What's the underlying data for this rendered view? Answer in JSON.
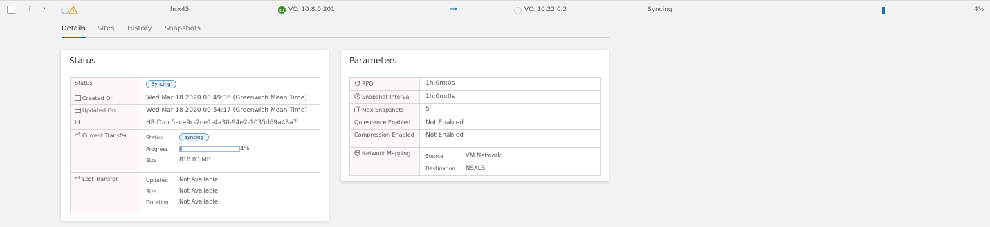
{
  "row": {
    "name": "hcx45",
    "source_vc": "VC: 10.8.0.201",
    "destination_vc": "VC: 10.22.0.2",
    "status": "Syncing",
    "progress_percent": 4,
    "progress_text": "4%"
  },
  "tabs": [
    "Details",
    "Sites",
    "History",
    "Snapshots"
  ],
  "status_card": {
    "title": "Status",
    "status_label": "Status",
    "status_value": "Syncing",
    "created_label": "Created On",
    "created_value": "Wed Mar 18 2020 00:49:36 (Greenwich Mean Time)",
    "updated_label": "Updated On",
    "updated_value": "Wed Mar 18 2020 00:54:17 (Greenwich Mean Time)",
    "id_label": "Id",
    "id_value": "HRID-dc5ace9c-2de1-4a30-94e2-1035d69a43a7",
    "current_transfer": {
      "label": "Current Transfer",
      "status_key": "Status",
      "status_value": "syncing",
      "progress_key": "Progress",
      "progress_percent": 4,
      "progress_text": "4%",
      "size_key": "Size",
      "size_value": "818.83 MB"
    },
    "last_transfer": {
      "label": "Last Transfer",
      "updated_key": "Updated",
      "updated_value": "Not Available",
      "size_key": "Size",
      "size_value": "Not Available",
      "duration_key": "Duration",
      "duration_value": "Not Available"
    }
  },
  "params_card": {
    "title": "Parameters",
    "rpo_label": "RPO",
    "rpo_value": "1h:0m:0s",
    "snapshot_interval_label": "Snapshot Interval",
    "snapshot_interval_value": "1h:0m:0s",
    "max_snapshots_label": "Max Snapshots",
    "max_snapshots_value": "5",
    "quiescence_label": "Quiescence Enabled",
    "quiescence_value": "Not Enabled",
    "compression_label": "Compression Enabled",
    "compression_value": "Not Enabled",
    "network_mapping": {
      "label": "Network Mapping",
      "source_key": "Source",
      "source_value": "VM Network",
      "destination_key": "Destination",
      "destination_value": "NSXLB"
    }
  },
  "colors": {
    "accent": "#0072a3",
    "progress_fill": "#6ea3cc",
    "badge_border": "#6aa0c8",
    "warning": "#e8a317",
    "power_on": "#3c8b26"
  },
  "icons": [
    "checkbox",
    "kebab-menu-icon",
    "chevron-down-icon",
    "sync-status-icon",
    "warning-icon",
    "power-on-icon",
    "arrow-right-icon",
    "vc-unknown-icon",
    "calendar-icon",
    "transfer-icon",
    "refresh-icon",
    "clock-icon",
    "snapshots-icon",
    "network-icon"
  ]
}
